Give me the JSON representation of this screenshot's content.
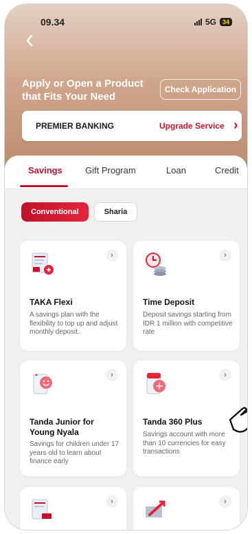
{
  "status_bar": {
    "time": "09.34",
    "network": "5G",
    "battery": "34"
  },
  "header": {
    "headline": "Apply or Open a Product that Fits Your Need",
    "check_button": "Check Application"
  },
  "premier": {
    "label": "PREMIER BANKING",
    "link": "Upgrade Service"
  },
  "tabs": [
    {
      "label": "Savings",
      "active": true
    },
    {
      "label": "Gift Program",
      "active": false
    },
    {
      "label": "Loan",
      "active": false
    },
    {
      "label": "Credit",
      "active": false
    }
  ],
  "filters": [
    {
      "label": "Conventional",
      "selected": true
    },
    {
      "label": "Sharia",
      "selected": false
    }
  ],
  "products": [
    {
      "title": "TAKA Flexi",
      "description": "A savings plan with the flexibility to top up and adjust monthly deposit.",
      "icon": "taka-flexi-icon"
    },
    {
      "title": "Time Deposit",
      "description": "Deposit savings starting from IDR 1 million with competitive rate",
      "icon": "time-deposit-icon"
    },
    {
      "title": "Tanda Junior for Young Nyala",
      "description": "Savings for children under 17 years old to learn about finance early",
      "icon": "tanda-junior-icon"
    },
    {
      "title": "Tanda 360 Plus",
      "description": "Savings account with more than 10 currencies for easy transactions",
      "icon": "tanda-360-icon"
    },
    {
      "title": "",
      "description": "",
      "icon": "document-rp-icon"
    },
    {
      "title": "",
      "description": "",
      "icon": "transfer-card-icon"
    }
  ],
  "colors": {
    "accent": "#c7102e",
    "hero_top": "#e4d0c4",
    "hero_bottom": "#bd8a6d"
  }
}
